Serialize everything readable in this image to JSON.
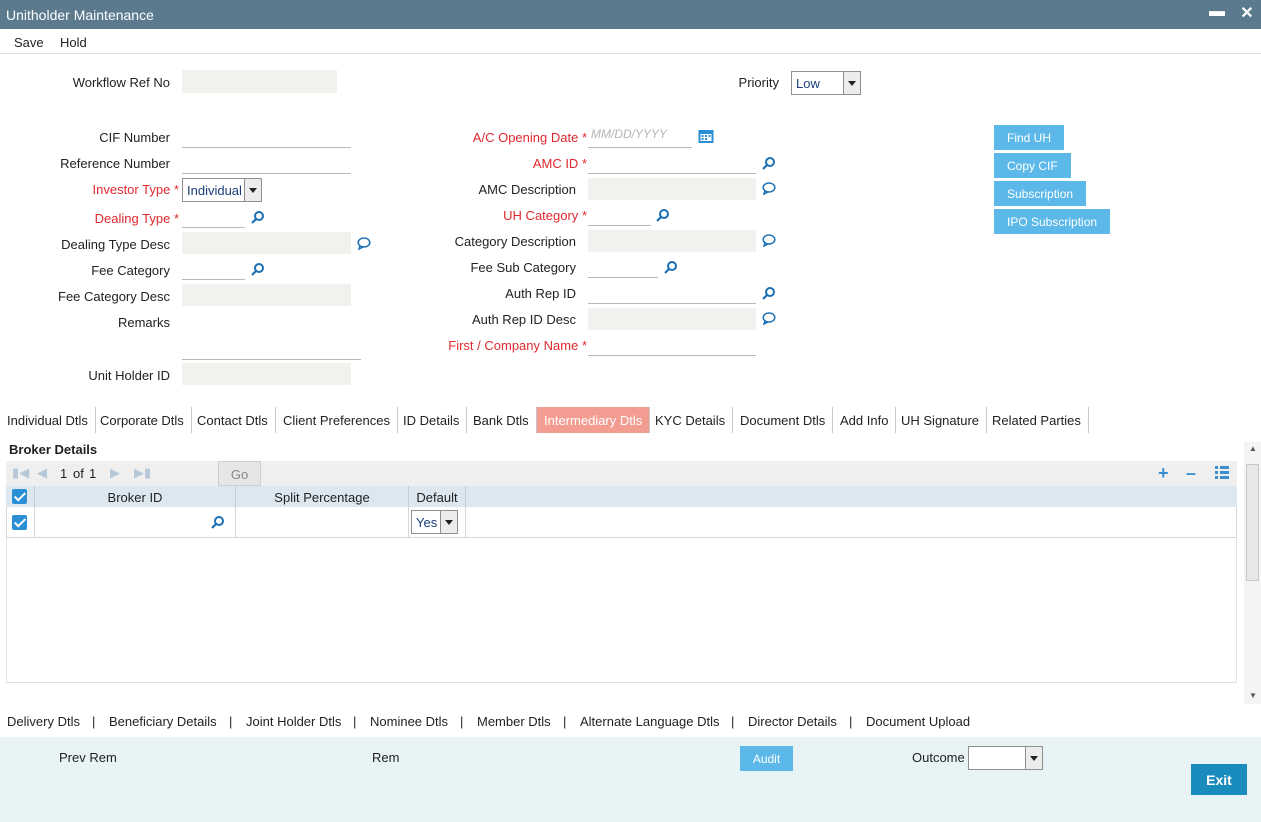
{
  "window": {
    "title": "Unitholder Maintenance",
    "minimize": "▬",
    "close": "✕"
  },
  "menu": {
    "save": "Save",
    "hold": "Hold"
  },
  "form": {
    "workflow_ref_no": {
      "label": "Workflow Ref No",
      "value": ""
    },
    "priority": {
      "label": "Priority",
      "value": "Low"
    },
    "cif_number": {
      "label": "CIF Number",
      "value": ""
    },
    "reference_number": {
      "label": "Reference Number",
      "value": ""
    },
    "investor_type": {
      "label": "Investor Type",
      "value": "Individual"
    },
    "dealing_type": {
      "label": "Dealing Type",
      "value": ""
    },
    "dealing_type_desc": {
      "label": "Dealing Type Desc",
      "value": ""
    },
    "fee_category": {
      "label": "Fee Category",
      "value": ""
    },
    "fee_category_desc": {
      "label": "Fee Category Desc",
      "value": ""
    },
    "remarks": {
      "label": "Remarks",
      "value": ""
    },
    "unit_holder_id": {
      "label": "Unit Holder ID",
      "value": ""
    },
    "ac_opening_date": {
      "label": "A/C Opening Date",
      "placeholder": "MM/DD/YYYY"
    },
    "amc_id": {
      "label": "AMC ID",
      "value": ""
    },
    "amc_description": {
      "label": "AMC Description",
      "value": ""
    },
    "uh_category": {
      "label": "UH Category",
      "value": ""
    },
    "category_description": {
      "label": "Category Description",
      "value": ""
    },
    "fee_sub_category": {
      "label": "Fee Sub Category",
      "value": ""
    },
    "auth_rep_id": {
      "label": "Auth Rep ID",
      "value": ""
    },
    "auth_rep_id_desc": {
      "label": "Auth Rep ID Desc",
      "value": ""
    },
    "first_company_name": {
      "label": "First / Company Name",
      "value": ""
    },
    "required_mark": "*"
  },
  "side_buttons": {
    "find_uh": "Find UH",
    "copy_cif": "Copy CIF",
    "subscription": "Subscription",
    "ipo_subscription": "IPO Subscription"
  },
  "tabs": [
    "Individual Dtls",
    "Corporate Dtls",
    "Contact Dtls",
    "Client Preferences",
    "ID Details",
    "Bank Dtls",
    "Intermediary Dtls",
    "KYC Details",
    "Document Dtls",
    "Add Info",
    "UH Signature",
    "Related Parties"
  ],
  "active_tab": "Intermediary Dtls",
  "broker": {
    "title": "Broker Details",
    "page_current": "1",
    "page_of": "of",
    "page_total": "1",
    "go": "Go",
    "columns": {
      "broker_id": "Broker ID",
      "split_percentage": "Split Percentage",
      "default": "Default"
    },
    "rows": [
      {
        "broker_id": "",
        "split_percentage": "",
        "default": "Yes"
      }
    ]
  },
  "bottom_links": [
    "Delivery Dtls",
    "Beneficiary Details",
    "Joint Holder Dtls",
    "Nominee Dtls",
    "Member Dtls",
    "Alternate Language Dtls",
    "Director Details",
    "Document Upload"
  ],
  "link_separator": "|",
  "footer": {
    "prev_rem": "Prev Rem",
    "rem": "Rem",
    "audit": "Audit",
    "outcome": "Outcome",
    "outcome_value": "",
    "exit": "Exit"
  },
  "colors": {
    "titlebar": "#5b7a8e",
    "accent": "#5bb8e8",
    "active_tab": "#f39c92",
    "required": "#e0292e",
    "exit": "#1a8bbd"
  }
}
